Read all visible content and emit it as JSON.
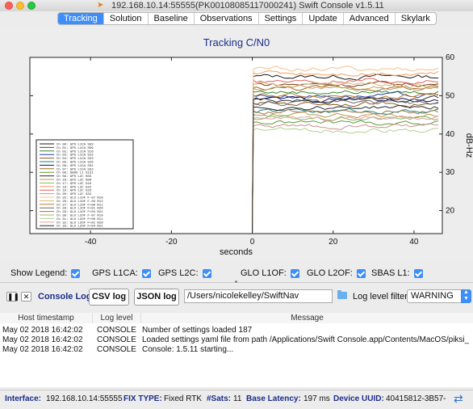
{
  "window": {
    "title": "192.168.10.14:55555(PK00108085117000241) Swift Console v1.5.11"
  },
  "tabs": [
    {
      "label": "Tracking",
      "active": true
    },
    {
      "label": "Solution",
      "active": false
    },
    {
      "label": "Baseline",
      "active": false
    },
    {
      "label": "Observations",
      "active": false
    },
    {
      "label": "Settings",
      "active": false
    },
    {
      "label": "Update",
      "active": false
    },
    {
      "label": "Advanced",
      "active": false
    },
    {
      "label": "Skylark",
      "active": false
    }
  ],
  "chart_data": {
    "type": "line",
    "title": "Tracking C/N0",
    "xlabel": "seconds",
    "ylabel": "dB-Hz",
    "xlim": [
      -55,
      47
    ],
    "ylim": [
      14,
      60
    ],
    "xticks": [
      -40,
      -20,
      0,
      20,
      40
    ],
    "yticks": [
      20,
      30,
      40,
      50,
      60
    ],
    "y_axis_side": "right",
    "grid": false,
    "legend_position": "bottom-left",
    "series": [
      {
        "name": "Ch 00: GPS L1CA S03",
        "color": "#1a1a1a",
        "level": 55
      },
      {
        "name": "Ch 01: GPS L1CA S09",
        "color": "#7a3b10",
        "level": 53
      },
      {
        "name": "Ch 02: GPS L1CA S16",
        "color": "#2a8a2a",
        "level": 51
      },
      {
        "name": "Ch 03: GPS L1CA S22",
        "color": "#1c3fa0",
        "level": 50
      },
      {
        "name": "Ch 04: GPS L1CA S23",
        "color": "#8a5a2a",
        "level": 48
      },
      {
        "name": "Ch 05: GPS L1CA S26",
        "color": "#1f7f7f",
        "level": 46
      },
      {
        "name": "Ch 06: GPS L1CA S31",
        "color": "#101060",
        "level": 49
      },
      {
        "name": "Ch 07: GPS L1CA S32",
        "color": "#a36a1e",
        "level": 52
      },
      {
        "name": "Ch 08: SBAS L1 S131",
        "color": "#5b9e3a",
        "level": 43
      },
      {
        "name": "Ch 09: GPS L2C S03",
        "color": "#2a2a2a",
        "level": 47
      },
      {
        "name": "Ch 16: GPS L2C S09",
        "color": "#b89a4a",
        "level": 45
      },
      {
        "name": "Ch 17: GPS L2C S16",
        "color": "#86b86a",
        "level": 44
      },
      {
        "name": "Ch 18: GPS L2C S22",
        "color": "#f0a060",
        "level": 56
      },
      {
        "name": "Ch 19: GPS L2C S23",
        "color": "#e06060",
        "level": 54
      },
      {
        "name": "Ch 20: GPS L2C S32",
        "color": "#d09090",
        "level": 42
      },
      {
        "name": "Ch 25: GLO L1OF F-07 R10",
        "color": "#f4c090",
        "level": 57
      },
      {
        "name": "Ch 26: GLO L1OF F-03 R12",
        "color": "#d8b870",
        "level": 53
      },
      {
        "name": "Ch 27: GLO L1OF F+00 R11",
        "color": "#c07830",
        "level": 50
      },
      {
        "name": "Ch 28: GLO L1OF F+01 R20",
        "color": "#6a6a6a",
        "level": 48
      },
      {
        "name": "Ch 29: GLO L1OF F+04 R21",
        "color": "#9a7a50",
        "level": 46
      },
      {
        "name": "Ch 30: GLO L2OF F-07 R10",
        "color": "#c0a070",
        "level": 52
      },
      {
        "name": "Ch 31: GLO L2OF F+00 R11",
        "color": "#b0d090",
        "level": 41
      },
      {
        "name": "Ch 32: GLO L2OF F+01 R20",
        "color": "#e8a0a0",
        "level": 44
      },
      {
        "name": "Ch 33: GLO L2OF F+04 R21",
        "color": "#303030",
        "level": 49
      }
    ],
    "track_start_x": 0,
    "track_end_x": 46
  },
  "legend_controls": {
    "show_legend": "Show Legend:",
    "gps_l1ca": "GPS L1CA:",
    "gps_l2c": "GPS L2C:",
    "glo_l1of": "GLO L1OF:",
    "glo_l2of": "GLO L2OF:",
    "sbas_l1": "SBAS L1:"
  },
  "console": {
    "pause_icon": "pause-icon",
    "clear_icon": "close-icon",
    "label": "Console Log",
    "csv_button": "CSV log",
    "json_button": "JSON log",
    "path": "/Users/nicolekelley/SwiftNav",
    "filter_label": "Log level filter:",
    "filter_value": "WARNING"
  },
  "log": {
    "headers": [
      "Host timestamp",
      "Log level",
      "Message"
    ],
    "rows": [
      {
        "ts": "May 02 2018 16:42:02",
        "level": "CONSOLE",
        "msg": "Number of settings loaded 187"
      },
      {
        "ts": "May 02 2018 16:42:02",
        "level": "CONSOLE",
        "msg": "Loaded settings yaml file from path /Applications/Swift Console.app/Contents/MacOS/piksi_tools/cons..."
      },
      {
        "ts": "May 02 2018 16:42:02",
        "level": "CONSOLE",
        "msg": "Console: 1.5.11 starting..."
      }
    ]
  },
  "status": {
    "interface_label": "Interface:",
    "interface_value": "192.168.10.14:55555",
    "fix_label": "FIX TYPE:",
    "fix_value": "Fixed RTK",
    "sats_label": "#Sats:",
    "sats_value": "11",
    "latency_label": "Base Latency:",
    "latency_value": "197 ms",
    "uuid_label": "Device UUID:",
    "uuid_value": "40415812-3B57-"
  }
}
